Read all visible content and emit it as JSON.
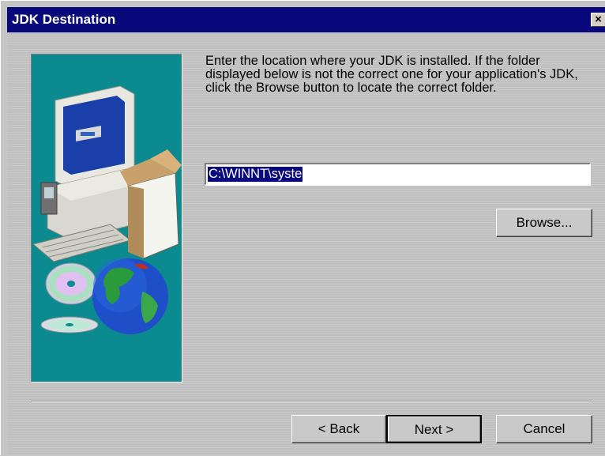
{
  "window": {
    "title": "JDK Destination",
    "close_label": "×"
  },
  "main": {
    "instructions": "Enter the location where your JDK is installed. If the folder displayed below is not the correct one for your application's JDK, click the Browse button to locate the correct folder.",
    "path_value": "C:\\WINNT\\syste"
  },
  "buttons": {
    "browse": "Browse...",
    "back": "< Back",
    "next": "Next >",
    "cancel": "Cancel"
  },
  "colors": {
    "titlebar": "#08087b",
    "art_background": "#0b8a90",
    "selection": "#0a0a80"
  },
  "icons": [
    "computer-icon",
    "cdrom-icon",
    "globe-icon",
    "box-icon"
  ]
}
